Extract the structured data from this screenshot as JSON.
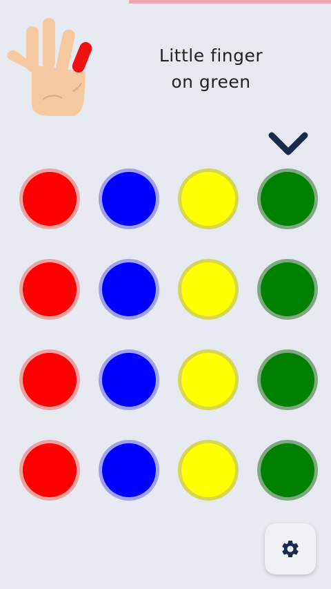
{
  "progress": {
    "fraction": 0.61,
    "color": "#f2a6b3"
  },
  "instruction": {
    "line1": "Little finger",
    "line2": "on green"
  },
  "hand_icon": {
    "name": "hand-icon",
    "highlighted_finger": "little",
    "highlight_color": "#ee1111"
  },
  "target_indicator": {
    "icon": "chevron-down-icon",
    "column": 3,
    "color": "#1a2a4a"
  },
  "colors": [
    {
      "name": "red",
      "fill": "#ff0000",
      "ring": "#f0a0a0"
    },
    {
      "name": "blue",
      "fill": "#0000ff",
      "ring": "#a0a0f0"
    },
    {
      "name": "yellow",
      "fill": "#ffff00",
      "ring": "#d6d650"
    },
    {
      "name": "green",
      "fill": "#008000",
      "ring": "#80a880"
    }
  ],
  "grid": {
    "rows": 4,
    "columns": 4
  },
  "settings": {
    "icon": "gear-icon",
    "color": "#1a2a4a"
  }
}
